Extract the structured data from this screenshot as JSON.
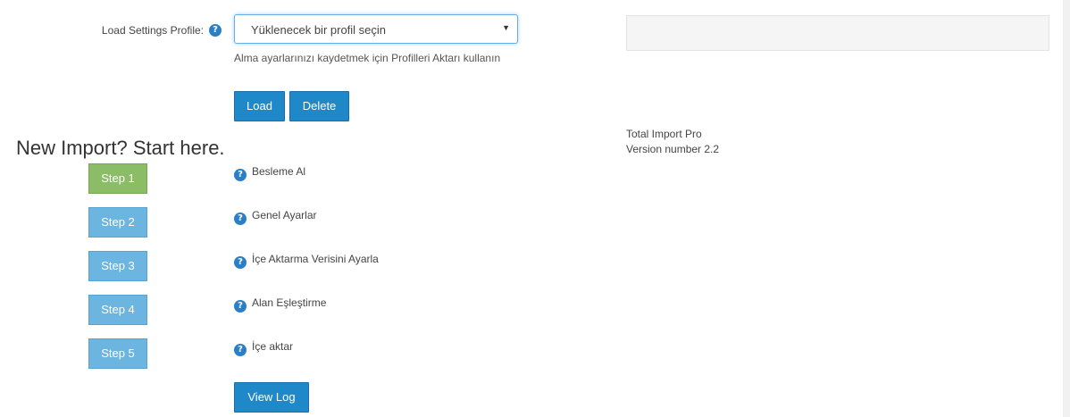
{
  "profile": {
    "label": "Load Settings Profile:",
    "select_value": "Yüklenecek bir profil seçin",
    "help_text": "Alma ayarlarınızı kaydetmek için Profilleri Aktarı kullanın",
    "load_label": "Load",
    "delete_label": "Delete"
  },
  "product": {
    "name": "Total Import Pro",
    "version": "Version number 2.2"
  },
  "steps": {
    "heading": "New Import? Start here.",
    "items": [
      {
        "button": "Step 1",
        "label": "Besleme Al",
        "active": true
      },
      {
        "button": "Step 2",
        "label": "Genel Ayarlar",
        "active": false
      },
      {
        "button": "Step 3",
        "label": "İçe Aktarma Verisini Ayarla",
        "active": false
      },
      {
        "button": "Step 4",
        "label": "Alan Eşleştirme",
        "active": false
      },
      {
        "button": "Step 5",
        "label": "İçe aktar",
        "active": false
      }
    ],
    "view_log_label": "View Log"
  },
  "icons": {
    "help": "question-circle-icon",
    "caret": "caret-down-icon"
  },
  "colors": {
    "primary": "#1e88c9",
    "step": "#6bb5e0",
    "step_active": "#8bbd66",
    "help_icon": "#2a7fc6"
  }
}
